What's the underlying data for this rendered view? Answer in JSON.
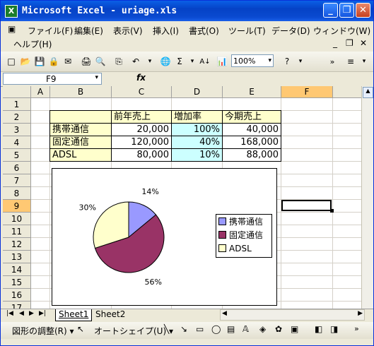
{
  "window": {
    "title": "Microsoft Excel - uriage.xls"
  },
  "menu": [
    "ファイル(F)",
    "編集(E)",
    "表示(V)",
    "挿入(I)",
    "書式(O)",
    "ツール(T)",
    "データ(D)",
    "ウィンドウ(W)",
    "ヘルプ(H)"
  ],
  "toolbar": {
    "zoom": "100%"
  },
  "formula": {
    "name_box": "F9",
    "fx": "fx"
  },
  "columns": [
    "A",
    "B",
    "C",
    "D",
    "E",
    "F"
  ],
  "rows": [
    "1",
    "2",
    "3",
    "4",
    "5",
    "6",
    "7",
    "8",
    "9",
    "10",
    "11",
    "12",
    "13",
    "14",
    "15",
    "16",
    "17"
  ],
  "table": {
    "headers": [
      "前年売上",
      "増加率",
      "今期売上"
    ],
    "rows": [
      {
        "label": "携帯通信",
        "prev": "20,000",
        "rate": "100%",
        "cur": "40,000"
      },
      {
        "label": "固定通信",
        "prev": "120,000",
        "rate": "40%",
        "cur": "168,000"
      },
      {
        "label": "ADSL",
        "prev": "80,000",
        "rate": "10%",
        "cur": "88,000"
      }
    ]
  },
  "chart_data": {
    "type": "pie",
    "categories": [
      "携帯通信",
      "固定通信",
      "ADSL"
    ],
    "values": [
      14,
      56,
      30
    ],
    "labels": [
      "14%",
      "56%",
      "30%"
    ],
    "colors": [
      "#9999ff",
      "#993366",
      "#ffffcc"
    ],
    "legend": "right"
  },
  "sheets": [
    "Sheet1",
    "Sheet2"
  ],
  "drawbar": {
    "adjust": "図形の調整(R) ▾",
    "autoshape": "オートシェイプ(U) ▾"
  }
}
